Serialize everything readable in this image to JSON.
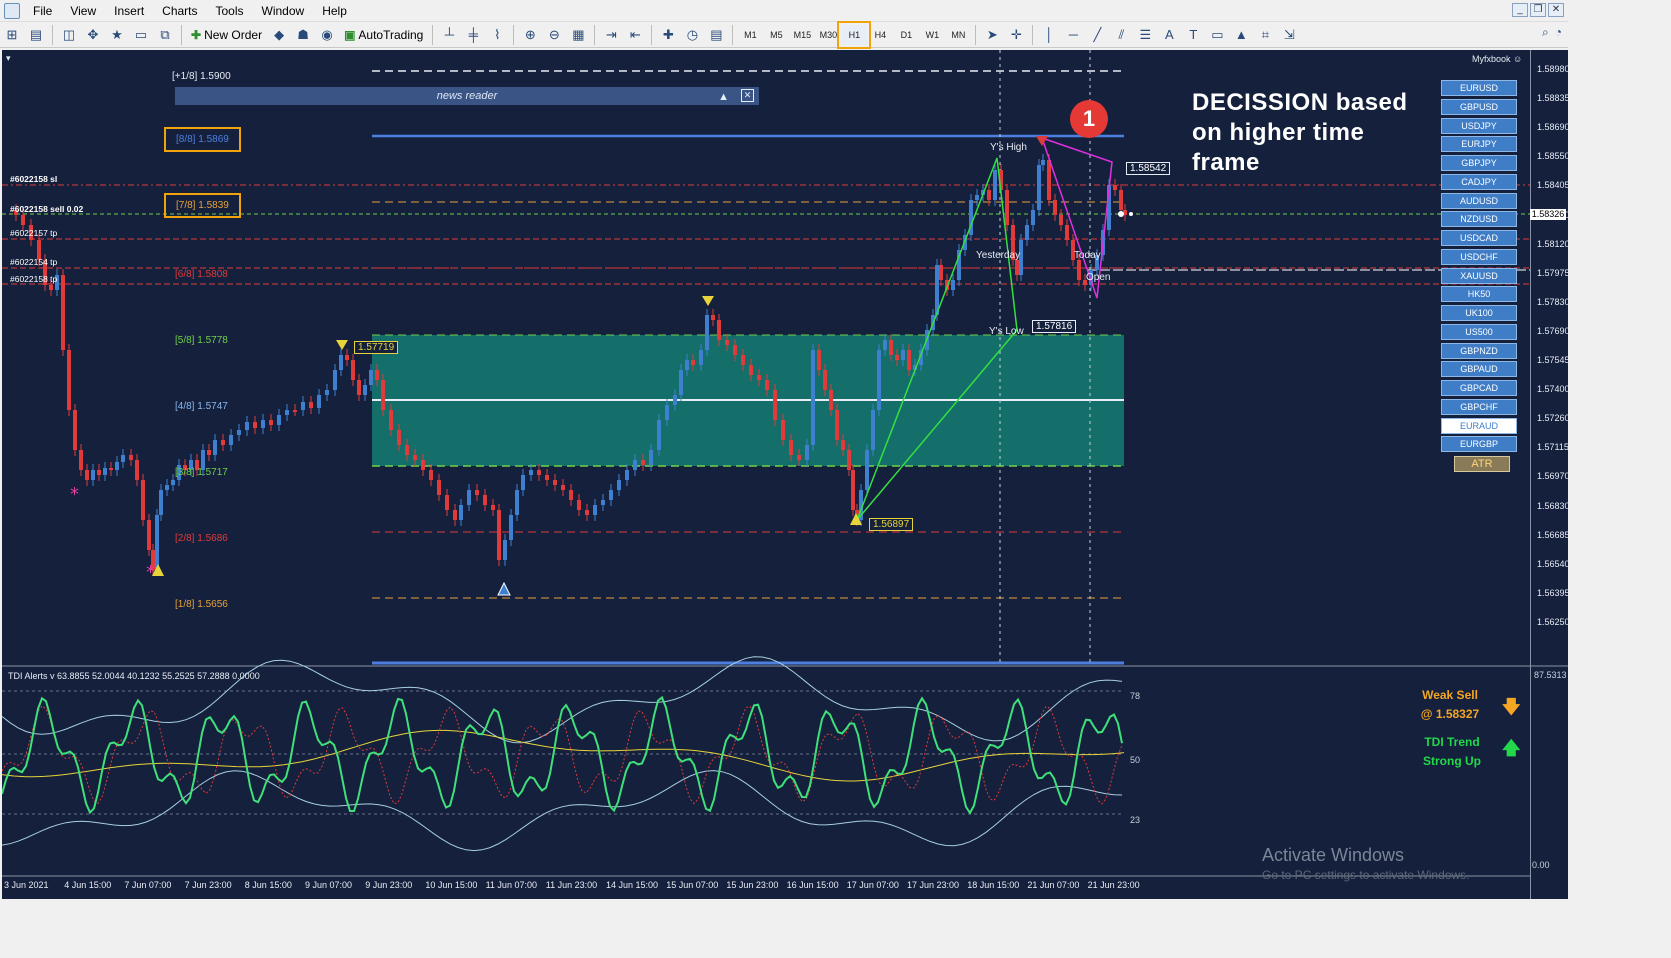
{
  "menu": {
    "items": [
      "File",
      "View",
      "Insert",
      "Charts",
      "Tools",
      "Window",
      "Help"
    ]
  },
  "toolbar": {
    "new_order": "New Order",
    "autotrading": "AutoTrading",
    "timeframes": [
      "M1",
      "M5",
      "M15",
      "M30",
      "H1",
      "H4",
      "D1",
      "W1",
      "MN"
    ],
    "active_timeframe": "H1"
  },
  "chart": {
    "myfxbook": "Myfxbook",
    "news_reader": "news reader",
    "decision_text": [
      "DECISSION based",
      "on higher time",
      "frame"
    ],
    "marker_number": "1",
    "murrey_levels": [
      {
        "label": "[+1/8]",
        "price": "1.5900",
        "color": "#e8ecf4"
      },
      {
        "label": "[8/8]",
        "price": "1.5869",
        "color": "#4d7fe0"
      },
      {
        "label": "[7/8]",
        "price": "1.5839",
        "color": "#e8a23a"
      },
      {
        "label": "[6/8]",
        "price": "1.5808",
        "color": "#e03a3a"
      },
      {
        "label": "[5/8]",
        "price": "1.5778",
        "color": "#6fd04a"
      },
      {
        "label": "[4/8]",
        "price": "1.5747",
        "color": "#88b8f0"
      },
      {
        "label": "[3/8]",
        "price": "1.5717",
        "color": "#6fd04a"
      },
      {
        "label": "[2/8]",
        "price": "1.5686",
        "color": "#e03a3a"
      },
      {
        "label": "[1/8]",
        "price": "1.5656",
        "color": "#e8a23a"
      }
    ],
    "orders": [
      {
        "text": "#6022158 sl"
      },
      {
        "text": "#6022158 sell 0.02"
      },
      {
        "text": "#6022157 tp"
      },
      {
        "text": "#6022154 tp"
      },
      {
        "text": "#6022158 tp"
      }
    ],
    "annotations": {
      "ys_high": "Y's High",
      "ys_low": "Y's Low",
      "yesterday": "Yesterday",
      "today": "Today",
      "open": "Open",
      "price_box_high": "1.58542",
      "price_box_low": "1.57816",
      "price_box_mid": "1.57719",
      "price_box_bottom": "1.56897"
    },
    "symbols": [
      "EURUSD",
      "GBPUSD",
      "USDJPY",
      "EURJPY",
      "GBPJPY",
      "CADJPY",
      "AUDUSD",
      "NZDUSD",
      "USDCAD",
      "USDCHF",
      "XAUUSD",
      "HK50",
      "UK100",
      "US500",
      "GBPNZD",
      "GBPAUD",
      "GBPCAD",
      "GBPCHF",
      "EURAUD",
      "EURGBP"
    ],
    "selected_symbol": "EURAUD",
    "atr_label": "ATR",
    "price_ticks": [
      "1.58980",
      "1.58835",
      "1.58690",
      "1.58550",
      "1.58405",
      "1.58260",
      "1.58120",
      "1.57975",
      "1.57830",
      "1.57690",
      "1.57545",
      "1.57400",
      "1.57260",
      "1.57115",
      "1.56970",
      "1.56830",
      "1.56685",
      "1.56540",
      "1.56395",
      "1.56250"
    ],
    "current_price": "1.58326",
    "time_ticks": [
      "3 Jun 2021",
      "4 Jun 15:00",
      "7 Jun 07:00",
      "7 Jun 23:00",
      "8 Jun 15:00",
      "9 Jun 07:00",
      "9 Jun 23:00",
      "10 Jun 15:00",
      "11 Jun 07:00",
      "11 Jun 23:00",
      "14 Jun 15:00",
      "15 Jun 07:00",
      "15 Jun 23:00",
      "16 Jun 15:00",
      "17 Jun 07:00",
      "17 Jun 23:00",
      "18 Jun 15:00",
      "21 Jun 07:00",
      "21 Jun 23:00"
    ]
  },
  "tdi": {
    "title": "TDI Alerts v 63.8855 52.0044 40.1232 55.2525 57.2888 0.0000",
    "scale_top": "87.5313",
    "level_78": "78",
    "level_50": "50",
    "level_23": "23",
    "scale_bottom": "0.00",
    "weak_sell": "Weak Sell",
    "weak_sell_price": "@ 1.58327",
    "trend_label": "TDI Trend",
    "trend_value": "Strong Up"
  },
  "watermark": {
    "title": "Activate Windows",
    "subtitle": "Go to PC settings to activate Windows."
  },
  "colors": {
    "chart_bg": "#14203c",
    "bull": "#3f7fd0",
    "bear": "#e03a3a",
    "zone": "#148a7a",
    "tdi_green": "#3fe07a",
    "tdi_yellow": "#e8d43a",
    "tdi_band": "#a8cfe0"
  }
}
